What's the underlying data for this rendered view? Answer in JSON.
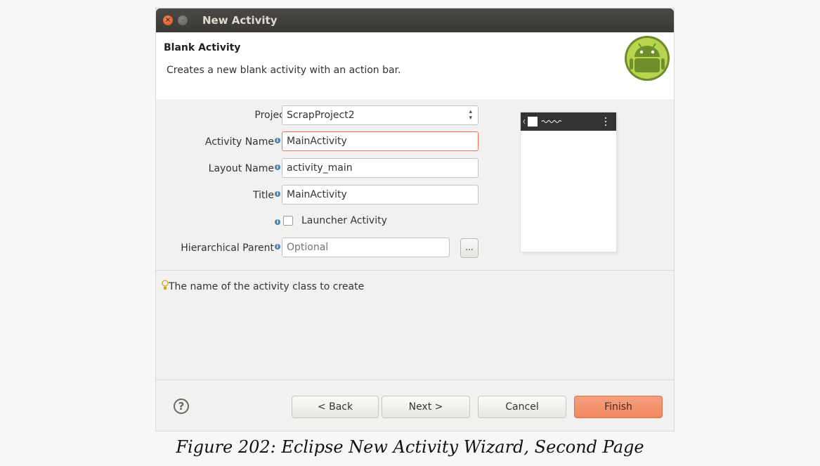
{
  "window": {
    "title": "New Activity",
    "close_glyph": "×",
    "minimize_glyph": "–"
  },
  "header": {
    "title": "Blank Activity",
    "description": "Creates a new blank activity with an action bar."
  },
  "form": {
    "project_label": "Project:",
    "project_value": "ScrapProject2",
    "activity_name_label": "Activity Name",
    "activity_name_value": "MainActivity",
    "layout_name_label": "Layout Name",
    "layout_name_value": "activity_main",
    "title_label": "Title",
    "title_value": "MainActivity",
    "launcher_label": "Launcher Activity",
    "launcher_checked": false,
    "parent_label": "Hierarchical Parent",
    "parent_placeholder": "Optional",
    "browse_label": "...",
    "info_glyph": "i"
  },
  "hint": "The name of the activity class to create",
  "buttons": {
    "help": "?",
    "back": "< Back",
    "next": "Next >",
    "cancel": "Cancel",
    "finish": "Finish"
  },
  "caption": "Figure 202: Eclipse New Activity Wizard, Second Page",
  "colors": {
    "titlebar": "#3c3b37",
    "finish_button": "#f08a63",
    "focused_border": "#e2775b",
    "android_green": "#a4c639"
  }
}
